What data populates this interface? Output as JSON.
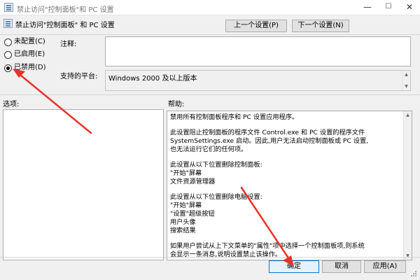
{
  "window": {
    "title": "禁止访问\"控制面板\"和 PC 设置",
    "minimize": "—",
    "maximize": "☐",
    "close": "✕"
  },
  "header": {
    "title": "禁止访问\"控制面板\" 和 PC 设置",
    "prev_button": "上一个设置(P)",
    "next_button": "下一个设置(N)"
  },
  "state": {
    "options": [
      {
        "label": "未配置(C)",
        "checked": false
      },
      {
        "label": "已启用(E)",
        "checked": false
      },
      {
        "label": "已禁用(D)",
        "checked": true
      }
    ]
  },
  "comment": {
    "label": "注释:",
    "value": ""
  },
  "platform": {
    "label": "支持的平台:",
    "value": "Windows 2000 及以上版本"
  },
  "options_section": {
    "label": "选项:"
  },
  "help_section": {
    "label": "帮助:",
    "paragraphs": [
      [
        "禁用所有控制面板程序和 PC 设置应用程序。"
      ],
      [
        "此设置阻止控制面板的程序文件 Control.exe 和 PC 设置的程序文件",
        "SystemSettings.exe 启动。因此,用户无法启动控制面板或 PC 设置,",
        "也无法运行它们的任何项。"
      ],
      [
        "此设置从以下位置删除控制面板:",
        "\"开始\"屏幕",
        "文件资源管理器"
      ],
      [
        "此设置从以下位置删除电脑设置:",
        "\"开始\"屏幕",
        "\"设置\"超级按钮",
        "用户头像",
        "搜索结果"
      ],
      [
        "如果用户尝试从上下文菜单的\"属性\"项中选择一个控制面板项,则系统",
        "会显示一条消息,说明设置禁止该操作。"
      ]
    ]
  },
  "footer": {
    "ok_button": "确定",
    "cancel_button": "取消",
    "apply_button": "应用(A)"
  },
  "colors": {
    "annotation_arrow": "#e8322b",
    "ok_border": "#0078d7"
  }
}
